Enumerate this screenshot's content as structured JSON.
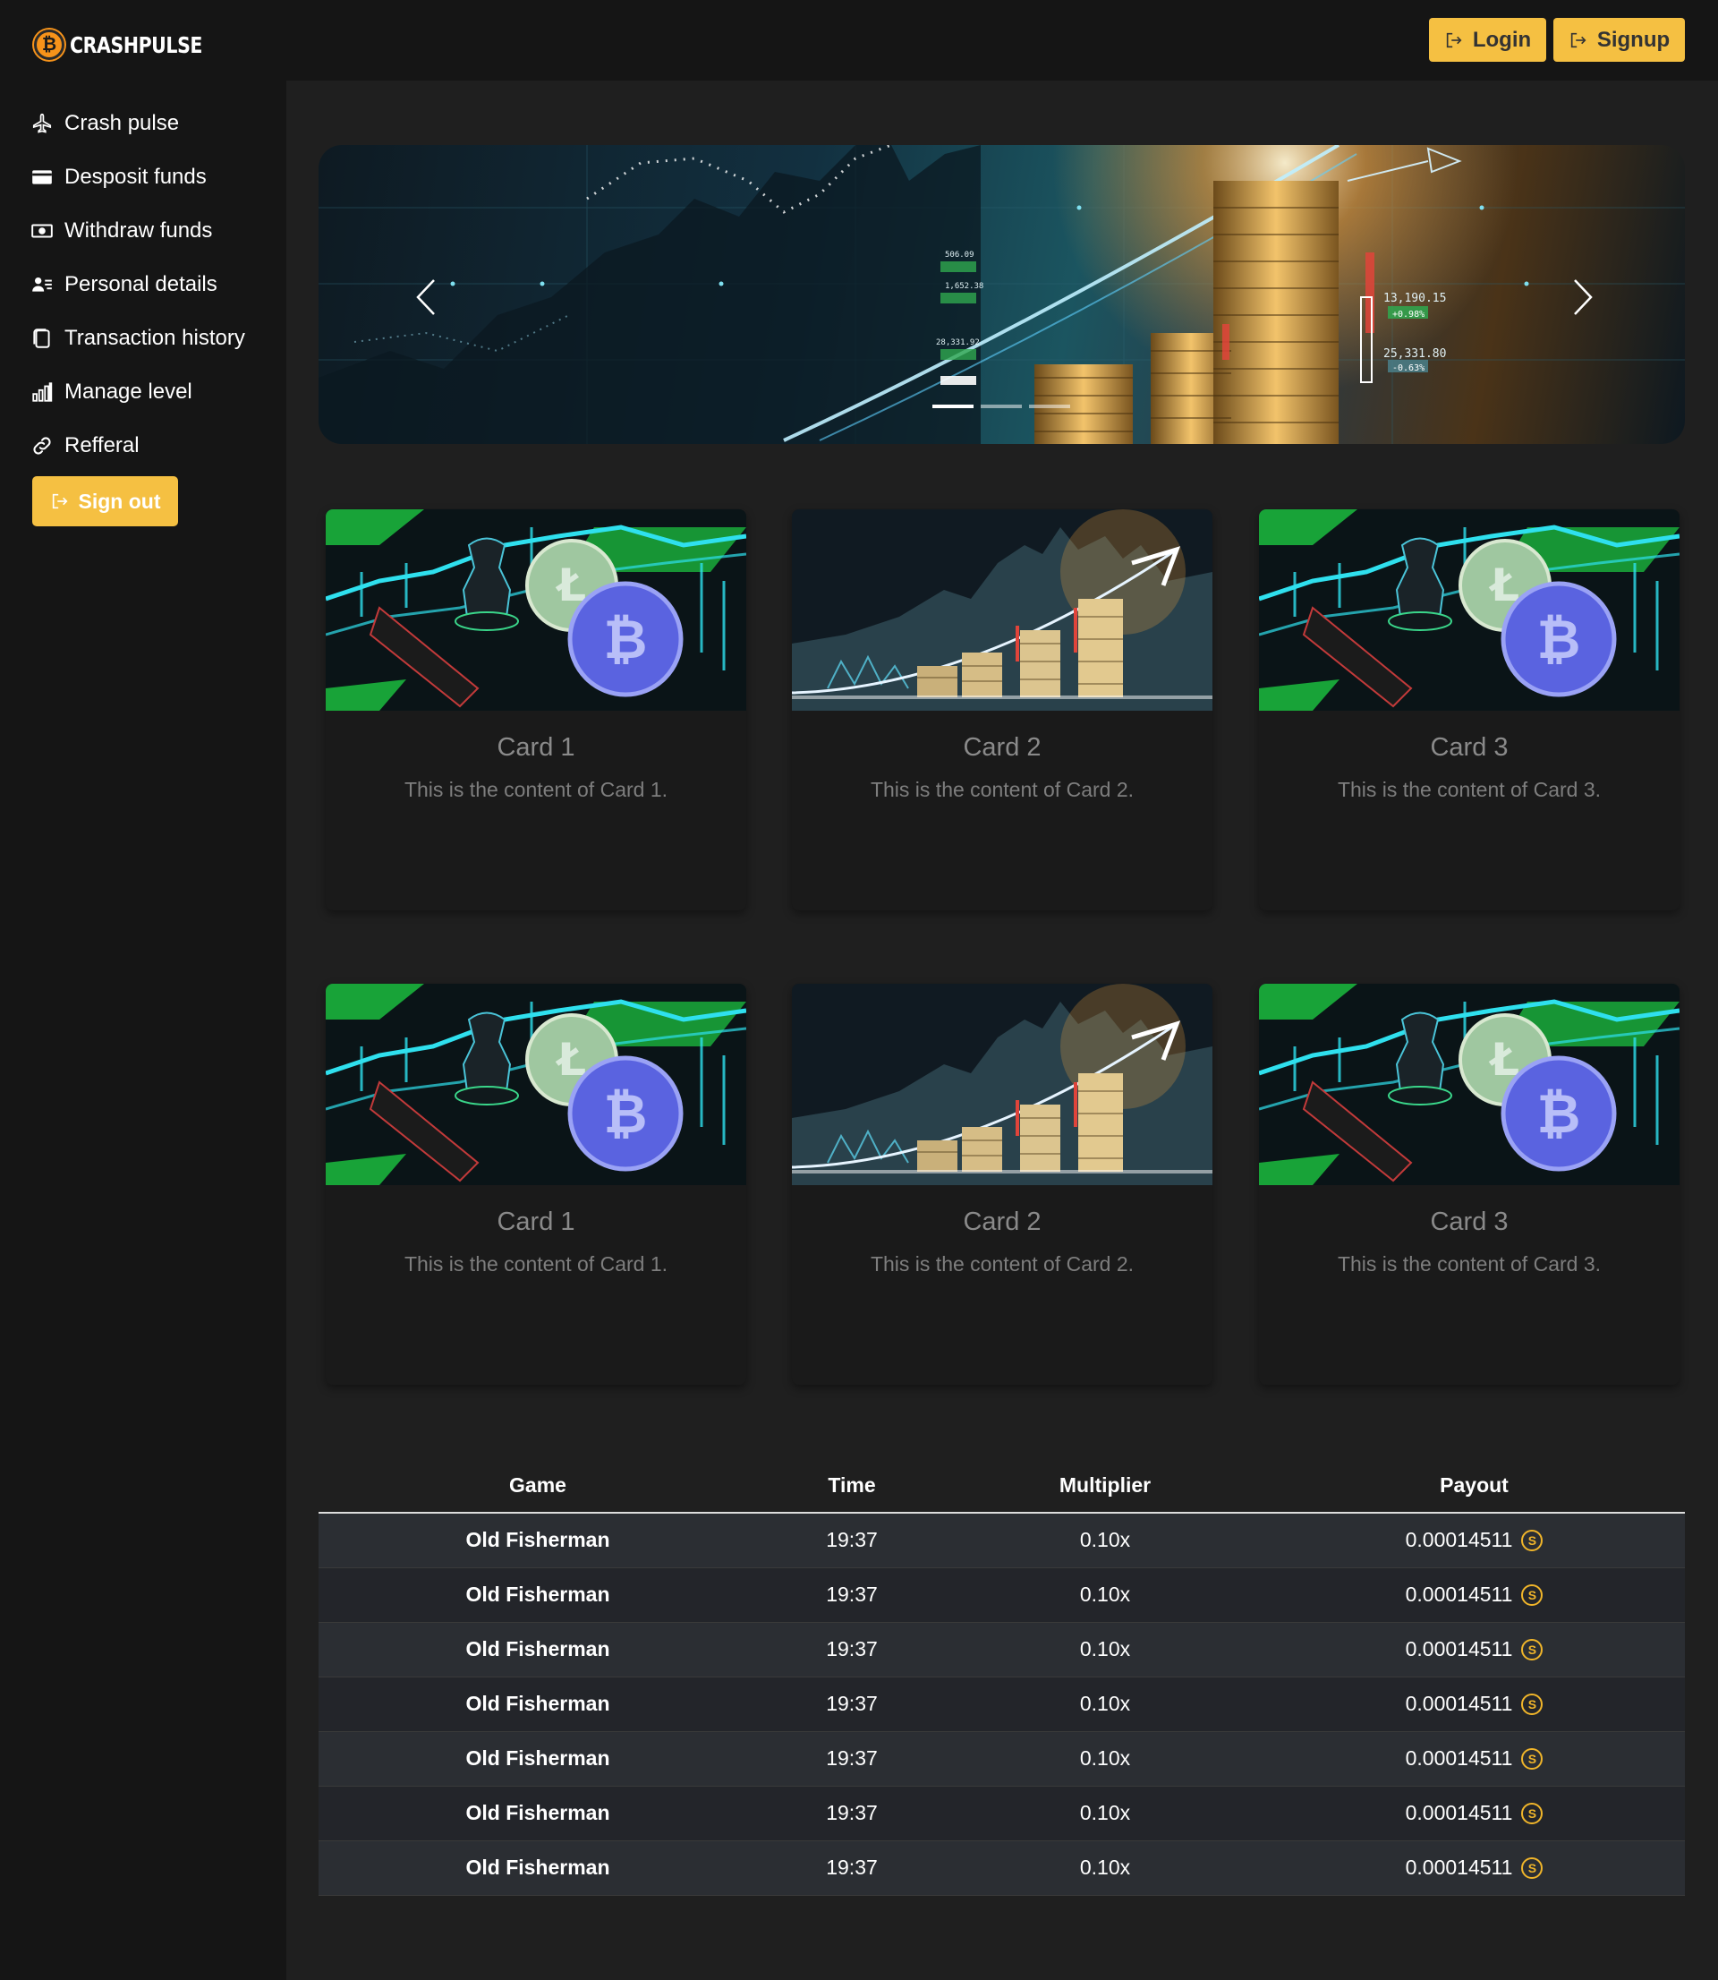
{
  "brand": {
    "name": "CRASHPULSE",
    "coin_glyph": "₿",
    "accent": "#f5c042",
    "coin_color": "#f7931a"
  },
  "header": {
    "login_label": "Login",
    "signup_label": "Signup"
  },
  "sidebar": {
    "items": [
      {
        "label": "Crash pulse",
        "icon": "airplane-icon"
      },
      {
        "label": "Desposit funds",
        "icon": "card-icon"
      },
      {
        "label": "Withdraw funds",
        "icon": "cash-icon"
      },
      {
        "label": "Personal details",
        "icon": "person-lines-icon"
      },
      {
        "label": "Transaction history",
        "icon": "copy-icon"
      },
      {
        "label": "Manage level",
        "icon": "bar-chart-icon"
      },
      {
        "label": "Refferal",
        "icon": "link-icon"
      }
    ],
    "signout_label": "Sign out"
  },
  "hero": {
    "indicators": 3,
    "active_indicator": 0,
    "ticker": [
      "13,190.15",
      "+0.98%",
      "25,331.80",
      "-0.63%",
      "506.09",
      "1,652.38",
      "28,331.92"
    ]
  },
  "cards_row1": [
    {
      "title": "Card 1",
      "text": "This is the content of Card 1."
    },
    {
      "title": "Card 2",
      "text": "This is the content of Card 2."
    },
    {
      "title": "Card 3",
      "text": "This is the content of Card 3."
    }
  ],
  "cards_row2": [
    {
      "title": "Card 1",
      "text": "This is the content of Card 1."
    },
    {
      "title": "Card 2",
      "text": "This is the content of Card 2."
    },
    {
      "title": "Card 3",
      "text": "This is the content of Card 3."
    }
  ],
  "table": {
    "headers": [
      "Game",
      "Time",
      "Multiplier",
      "Payout"
    ],
    "rows": [
      {
        "game": "Old Fisherman",
        "time": "19:37",
        "multiplier": "0.10x",
        "payout": "0.00014511"
      },
      {
        "game": "Old Fisherman",
        "time": "19:37",
        "multiplier": "0.10x",
        "payout": "0.00014511"
      },
      {
        "game": "Old Fisherman",
        "time": "19:37",
        "multiplier": "0.10x",
        "payout": "0.00014511"
      },
      {
        "game": "Old Fisherman",
        "time": "19:37",
        "multiplier": "0.10x",
        "payout": "0.00014511"
      },
      {
        "game": "Old Fisherman",
        "time": "19:37",
        "multiplier": "0.10x",
        "payout": "0.00014511"
      },
      {
        "game": "Old Fisherman",
        "time": "19:37",
        "multiplier": "0.10x",
        "payout": "0.00014511"
      },
      {
        "game": "Old Fisherman",
        "time": "19:37",
        "multiplier": "0.10x",
        "payout": "0.00014511"
      }
    ],
    "coin_glyph": "S"
  }
}
